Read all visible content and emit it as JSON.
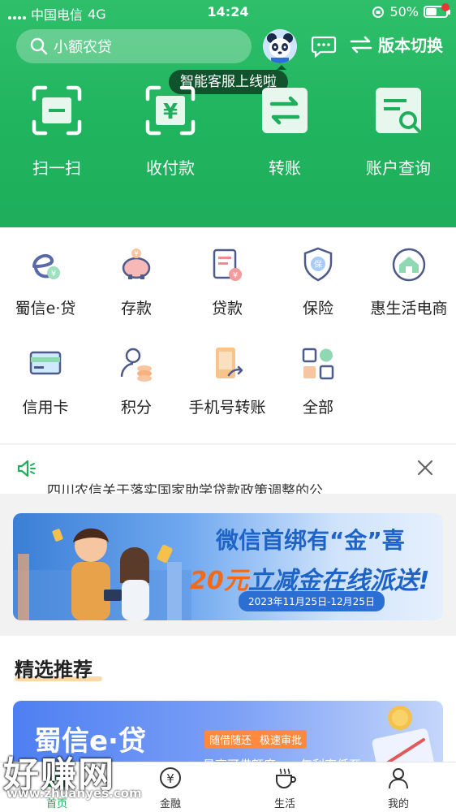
{
  "status": {
    "carrier": "中国电信",
    "network": "4G",
    "time": "14:24",
    "battery": "50%",
    "battery_level": 0.5
  },
  "header": {
    "search_placeholder": "小额农贷",
    "version_switch": "版本切换",
    "tooltip": "智能客服上线啦",
    "quick_actions": [
      {
        "label": "扫一扫",
        "icon": "scan-icon"
      },
      {
        "label": "收付款",
        "icon": "payment-icon"
      },
      {
        "label": "转账",
        "icon": "transfer-icon"
      },
      {
        "label": "账户查询",
        "icon": "account-query-icon"
      }
    ]
  },
  "services": [
    {
      "label": "蜀信e·贷",
      "icon": "e-loan-icon"
    },
    {
      "label": "存款",
      "icon": "piggy-bank-icon"
    },
    {
      "label": "贷款",
      "icon": "loan-icon"
    },
    {
      "label": "保险",
      "icon": "insurance-shield-icon"
    },
    {
      "label": "惠生活电商",
      "icon": "ecommerce-icon"
    },
    {
      "label": "信用卡",
      "icon": "credit-card-icon"
    },
    {
      "label": "积分",
      "icon": "points-icon"
    },
    {
      "label": "手机号转账",
      "icon": "phone-transfer-icon"
    },
    {
      "label": "全部",
      "icon": "all-grid-icon"
    }
  ],
  "notice": {
    "text": "四川农信关于落实国家助学贷款政策调整的公"
  },
  "banner": {
    "line1": "微信首绑有“金”喜",
    "line2_amount": "20元",
    "line2_rest": "立减金在线派送!",
    "date_range": "2023年11月25日-12月25日"
  },
  "recommend": {
    "title": "精选推荐",
    "card_brand": "蜀信e·贷",
    "tag1": "随借随还",
    "tag2": "极速审批",
    "sub1": "最高可借额度",
    "sub2": "年利率低至"
  },
  "tabs": [
    {
      "label": "首页",
      "icon": "home-icon",
      "active": true
    },
    {
      "label": "金融",
      "icon": "finance-icon",
      "active": false
    },
    {
      "label": "生活",
      "icon": "life-cup-icon",
      "active": false
    },
    {
      "label": "我的",
      "icon": "profile-icon",
      "active": false
    }
  ],
  "watermark": {
    "text": "好赚网",
    "sub": "www.zhuanyes.com"
  },
  "colors": {
    "brand_green": "#1fae5b",
    "accent_orange": "#f06a1a",
    "banner_blue": "#1e63c7"
  }
}
